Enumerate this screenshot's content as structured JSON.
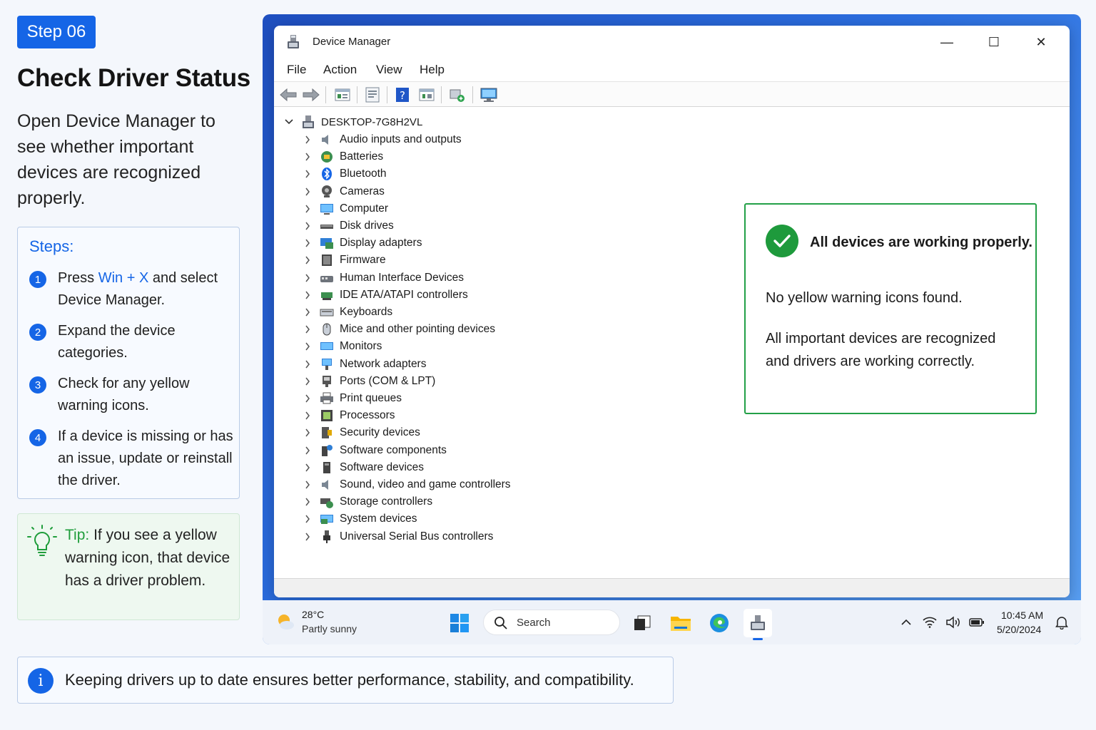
{
  "guide": {
    "step_badge": "Step 06",
    "title": "Check Driver Status",
    "description": "Open Device Manager to see whether important devices are recognized properly.",
    "steps_title": "Steps:",
    "steps": [
      {
        "num": "1",
        "pre": "Press ",
        "key1": "Win",
        "plus": " + ",
        "key2": "X",
        "post": " and select Device Manager."
      },
      {
        "num": "2",
        "text": "Expand the device categories."
      },
      {
        "num": "3",
        "text": "Check for any yellow warning icons."
      },
      {
        "num": "4",
        "text": "If a device is missing or has an issue, update or reinstall the driver."
      }
    ],
    "tip_label": "Tip:",
    "tip_text": " If you see a yellow warning icon, that device has a driver problem.",
    "info_icon": "i",
    "info_text": "Keeping drivers up to date ensures better performance, stability, and compatibility."
  },
  "window": {
    "title": "Device Manager",
    "controls": {
      "minimize": "—",
      "maximize": "☐",
      "close": "✕"
    },
    "menu": [
      "File",
      "Action",
      "View",
      "Help"
    ],
    "toolbar_icons": [
      "back-icon",
      "forward-icon",
      "properties-icon",
      "update-driver-icon",
      "help-icon",
      "view-icon",
      "scan-hardware-icon",
      "monitor-icon"
    ],
    "root": "DESKTOP-7G8H2VL",
    "categories": [
      {
        "label": "Audio inputs and outputs",
        "icon": "speaker-icon"
      },
      {
        "label": "Batteries",
        "icon": "battery-icon"
      },
      {
        "label": "Bluetooth",
        "icon": "bluetooth-icon"
      },
      {
        "label": "Cameras",
        "icon": "camera-icon"
      },
      {
        "label": "Computer",
        "icon": "computer-icon"
      },
      {
        "label": "Disk drives",
        "icon": "disk-icon"
      },
      {
        "label": "Display adapters",
        "icon": "display-adapter-icon"
      },
      {
        "label": "Firmware",
        "icon": "firmware-icon"
      },
      {
        "label": "Human Interface Devices",
        "icon": "hid-icon"
      },
      {
        "label": "IDE ATA/ATAPI controllers",
        "icon": "ide-icon"
      },
      {
        "label": "Keyboards",
        "icon": "keyboard-icon"
      },
      {
        "label": "Mice and other pointing devices",
        "icon": "mouse-icon"
      },
      {
        "label": "Monitors",
        "icon": "monitor-icon"
      },
      {
        "label": "Network adapters",
        "icon": "network-icon"
      },
      {
        "label": "Ports (COM & LPT)",
        "icon": "port-icon"
      },
      {
        "label": "Print queues",
        "icon": "printer-icon"
      },
      {
        "label": "Processors",
        "icon": "processor-icon"
      },
      {
        "label": "Security devices",
        "icon": "security-icon"
      },
      {
        "label": "Software components",
        "icon": "software-component-icon"
      },
      {
        "label": "Software devices",
        "icon": "software-device-icon"
      },
      {
        "label": "Sound, video and game controllers",
        "icon": "sound-icon"
      },
      {
        "label": "Storage controllers",
        "icon": "storage-icon"
      },
      {
        "label": "System devices",
        "icon": "system-icon"
      },
      {
        "label": "Universal Serial Bus controllers",
        "icon": "usb-icon"
      }
    ],
    "status_card": {
      "heading": "All devices are working properly.",
      "line1": "No yellow warning icons found.",
      "line2": "All important devices are recognized and drivers are working correctly."
    }
  },
  "taskbar": {
    "temperature": "28°C",
    "weather": "Partly sunny",
    "search_label": "Search",
    "time": "10:45 AM",
    "date": "5/20/2024"
  },
  "colors": {
    "accent": "#1565e6",
    "success": "#1e9a3c",
    "tip": "#1f9d3b"
  }
}
